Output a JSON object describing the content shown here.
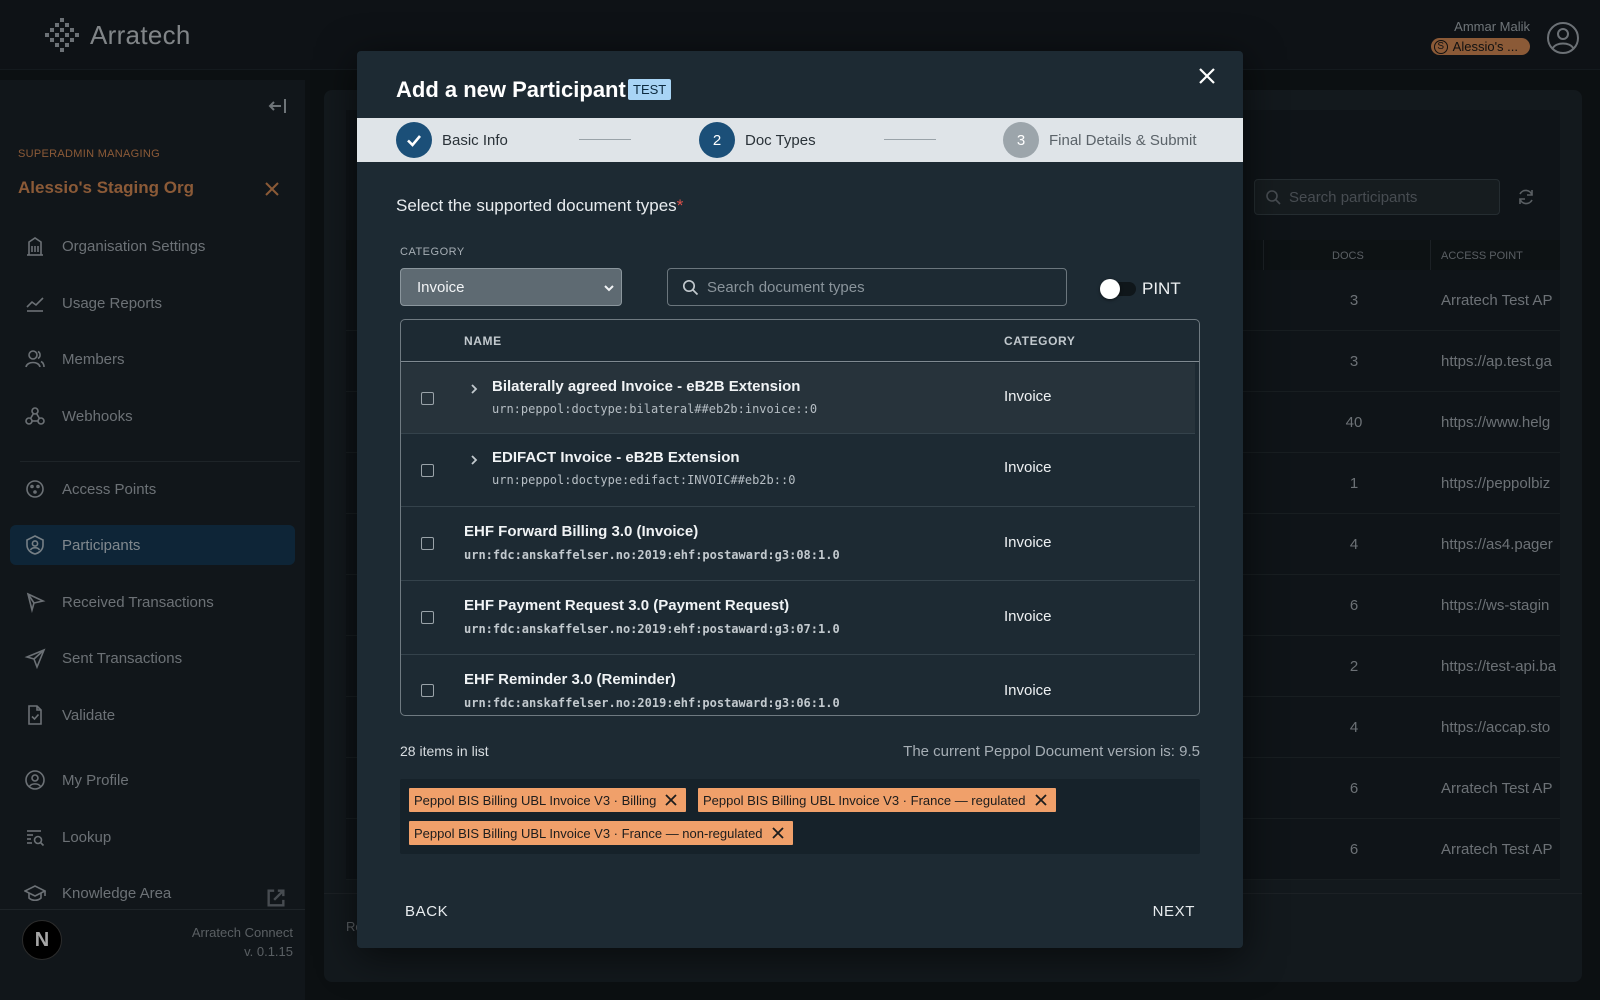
{
  "header": {
    "brand": "Arratech",
    "user_name": "Ammar Malik",
    "org_badge_initial": "S",
    "org_badge_label": "Alessio's ..."
  },
  "sidebar": {
    "managing_label": "SUPERADMIN MANAGING",
    "org_name": "Alessio's Staging Org",
    "items": [
      {
        "label": "Organisation Settings",
        "icon": "building-icon"
      },
      {
        "label": "Usage Reports",
        "icon": "chart-line-icon"
      },
      {
        "label": "Members",
        "icon": "users-icon"
      },
      {
        "label": "Webhooks",
        "icon": "webhook-icon"
      },
      {
        "label": "Access Points",
        "icon": "access-point-icon"
      },
      {
        "label": "Participants",
        "icon": "participant-icon",
        "active": true
      },
      {
        "label": "Received Transactions",
        "icon": "received-icon"
      },
      {
        "label": "Sent Transactions",
        "icon": "send-icon"
      },
      {
        "label": "Validate",
        "icon": "file-check-icon"
      },
      {
        "label": "My Profile",
        "icon": "user-circle-icon"
      },
      {
        "label": "Lookup",
        "icon": "lookup-icon"
      },
      {
        "label": "Knowledge Area",
        "icon": "graduation-cap-icon"
      }
    ],
    "footer": {
      "badge": "N",
      "app_name": "Arratech Connect",
      "version": "v. 0.1.15"
    }
  },
  "background": {
    "search_placeholder": "Search participants",
    "col_docs": "DOCS",
    "col_access_point": "ACCESS POINT",
    "rows": [
      {
        "docs": "3",
        "ap": "Arratech Test AP"
      },
      {
        "docs": "3",
        "ap": "https://ap.test.ga"
      },
      {
        "docs": "40",
        "ap": "https://www.helg"
      },
      {
        "docs": "1",
        "ap": "https://peppolbiz"
      },
      {
        "docs": "4",
        "ap": "https://as4.pager"
      },
      {
        "docs": "6",
        "ap": "https://ws-stagin"
      },
      {
        "docs": "2",
        "ap": "https://test-api.ba"
      },
      {
        "docs": "4",
        "ap": "https://accap.sto"
      },
      {
        "docs": "6",
        "ap": "Arratech Test AP"
      },
      {
        "docs": "6",
        "ap": "Arratech Test AP"
      }
    ],
    "footer_text": "Ro"
  },
  "modal": {
    "title": "Add a new Participant",
    "badge": "TEST",
    "steps": [
      {
        "number": "",
        "label": "Basic Info",
        "state": "done"
      },
      {
        "number": "2",
        "label": "Doc Types",
        "state": "active"
      },
      {
        "number": "3",
        "label": "Final Details & Submit",
        "state": "pending"
      }
    ],
    "section_title": "Select the supported document types",
    "required_mark": "*",
    "category_label": "CATEGORY",
    "category_value": "Invoice",
    "search_placeholder": "Search document types",
    "pint_label": "PINT",
    "pint_on": false,
    "table": {
      "col_name": "NAME",
      "col_category": "CATEGORY",
      "rows": [
        {
          "name": "Bilaterally agreed Invoice - eB2B Extension",
          "urn": "urn:peppol:doctype:bilateral##eb2b:invoice::0",
          "category": "Invoice",
          "expandable": true
        },
        {
          "name": "EDIFACT Invoice - eB2B Extension",
          "urn": "urn:peppol:doctype:edifact:INVOIC##eb2b::0",
          "category": "Invoice",
          "expandable": true
        },
        {
          "name": "EHF Forward Billing 3.0 (Invoice)",
          "urn": "urn:fdc:anskaffelser.no:2019:ehf:postaward:g3:08:1.0",
          "category": "Invoice",
          "expandable": false
        },
        {
          "name": "EHF Payment Request 3.0 (Payment Request)",
          "urn": "urn:fdc:anskaffelser.no:2019:ehf:postaward:g3:07:1.0",
          "category": "Invoice",
          "expandable": false
        },
        {
          "name": "EHF Reminder 3.0 (Reminder)",
          "urn": "urn:fdc:anskaffelser.no:2019:ehf:postaward:g3:06:1.0",
          "category": "Invoice",
          "expandable": false
        }
      ]
    },
    "items_count": "28 items in list",
    "peppol_version": "The current Peppol Document version is: 9.5",
    "selected": [
      "Peppol BIS Billing UBL Invoice V3 · Billing",
      "Peppol BIS Billing UBL Invoice V3 · France — regulated",
      "Peppol BIS Billing UBL Invoice V3 · France — non-regulated"
    ],
    "back_label": "BACK",
    "next_label": "NEXT"
  }
}
